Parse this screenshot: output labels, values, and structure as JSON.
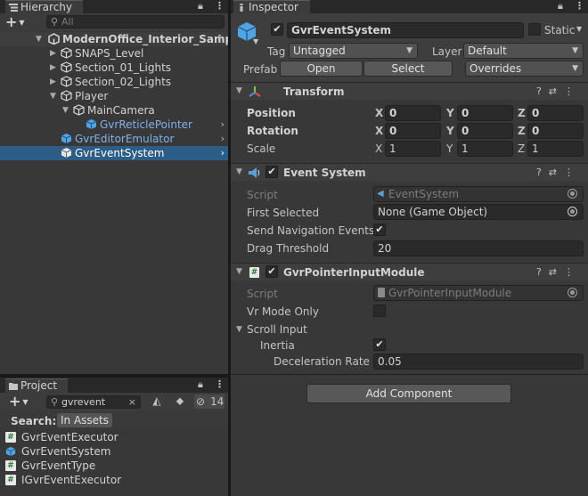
{
  "colors": {
    "selection": "#2c5d87",
    "cube_blue": "#4ea5e6",
    "cube_white": "#d8d8d8",
    "prefab_text": "#7fb3e8"
  },
  "hierarchy": {
    "tab_label": "Hierarchy",
    "add_label": "+",
    "search_placeholder": "All",
    "items": [
      {
        "label": "ModernOffice_Interior_Samp",
        "icon": "unity-scene-icon"
      },
      {
        "label": "SNAPS_Level",
        "icon": "gameobject-cube-icon"
      },
      {
        "label": "Section_01_Lights",
        "icon": "gameobject-cube-icon"
      },
      {
        "label": "Section_02_Lights",
        "icon": "gameobject-cube-icon"
      },
      {
        "label": "Player",
        "icon": "gameobject-cube-icon"
      },
      {
        "label": "MainCamera",
        "icon": "gameobject-cube-icon"
      },
      {
        "label": "GvrReticlePointer",
        "icon": "prefab-cube-icon"
      },
      {
        "label": "GvrEditorEmulator",
        "icon": "prefab-cube-icon"
      },
      {
        "label": "GvrEventSystem",
        "icon": "gameobject-cube-icon"
      }
    ]
  },
  "project": {
    "tab_label": "Project",
    "add_label": "+",
    "search_value": "gvrevent",
    "search_label": "Search:",
    "scope_label": "In Assets",
    "hidden_count": "14",
    "items": [
      {
        "label": "GvrEventExecutor",
        "icon": "csharp-script-icon"
      },
      {
        "label": "GvrEventSystem",
        "icon": "prefab-cube-icon"
      },
      {
        "label": "GvrEventType",
        "icon": "csharp-script-icon"
      },
      {
        "label": "IGvrEventExecutor",
        "icon": "csharp-script-icon"
      }
    ]
  },
  "inspector": {
    "tab_label": "Inspector",
    "object_name": "GvrEventSystem",
    "static_label": "Static",
    "tag_label": "Tag",
    "tag_value": "Untagged",
    "layer_label": "Layer",
    "layer_value": "Default",
    "prefab_label": "Prefab",
    "open_label": "Open",
    "select_label": "Select",
    "overrides_label": "Overrides",
    "transform": {
      "title": "Transform",
      "position_label": "Position",
      "rotation_label": "Rotation",
      "scale_label": "Scale",
      "axis_x": "X",
      "axis_y": "Y",
      "axis_z": "Z",
      "position": [
        "0",
        "0",
        "0"
      ],
      "rotation": [
        "0",
        "0",
        "0"
      ],
      "scale": [
        "1",
        "1",
        "1"
      ]
    },
    "event_system": {
      "title": "Event System",
      "script_label": "Script",
      "script_value": "EventSystem",
      "first_selected_label": "First Selected",
      "first_selected_value": "None (Game Object)",
      "send_nav_label": "Send Navigation Events",
      "drag_threshold_label": "Drag Threshold",
      "drag_threshold_value": "20"
    },
    "pointer_module": {
      "title": "GvrPointerInputModule",
      "script_label": "Script",
      "script_value": "GvrPointerInputModule",
      "vr_mode_label": "Vr Mode Only",
      "scroll_input_label": "Scroll Input",
      "inertia_label": "Inertia",
      "decel_label": "Deceleration Rate",
      "decel_value": "0.05"
    },
    "add_component_label": "Add Component"
  }
}
